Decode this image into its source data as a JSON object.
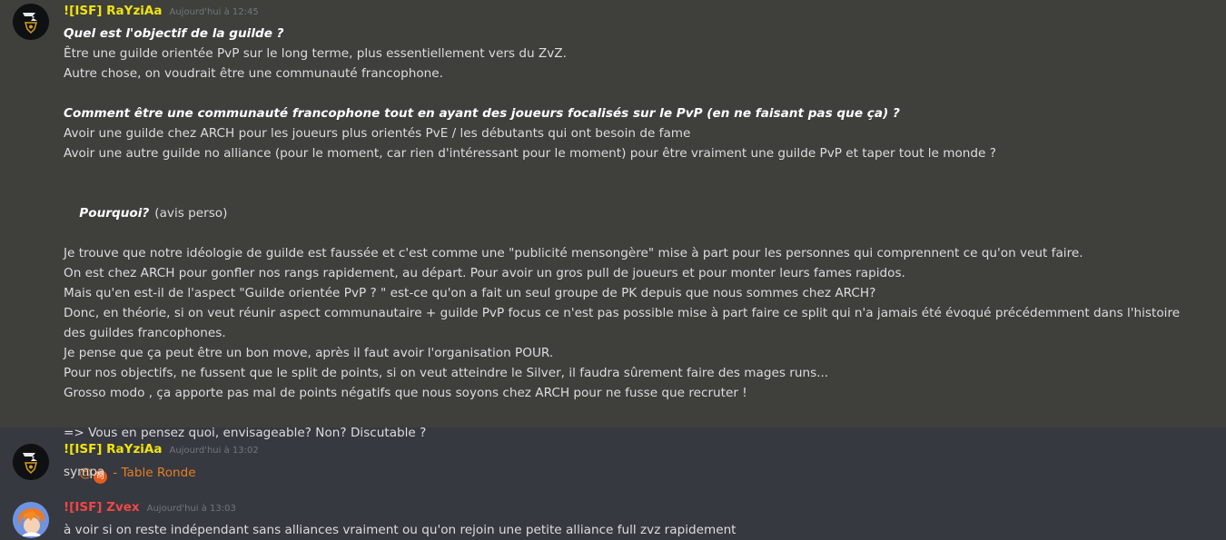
{
  "messages": {
    "m1": {
      "author": "![ISF] RaYziAa",
      "author_color": "#f1e40d",
      "timestamp": "Aujourd'hui à 12:45",
      "lines": {
        "l1": "Quel est l'objectif de la guilde ?",
        "l2": "Être une guilde orientée PvP sur le long terme, plus essentiellement vers du ZvZ.",
        "l3": "Autre chose, on voudrait être une communauté francophone.",
        "l5": "Comment être une communauté francophone tout en ayant des joueurs focalisés sur le PvP (en ne faisant pas que ça) ?",
        "l6": "Avoir une guilde chez ARCH pour les joueurs plus orientés PvE / les débutants qui ont besoin de fame",
        "l7": "Avoir une autre guilde no alliance (pour le moment, car rien d'intéressant pour le moment) pour être vraiment une guilde PvP et taper tout le monde ?",
        "l9": "Pourquoi?",
        "l9_note": "(avis perso)",
        "l10": "Je trouve que notre idéologie de guilde est faussée et c'est comme une \"publicité mensongère\" mise à part pour les personnes qui comprennent ce qu'on veut faire.",
        "l11": "On est chez ARCH pour gonfler nos rangs rapidement, au départ. Pour avoir un gros pull de joueurs et pour monter leurs fames rapidos.",
        "l12": "Mais qu'en est-il de l'aspect \"Guilde orientée PvP ? \" est-ce qu'on a fait un seul groupe de PK depuis que nous sommes chez ARCH?",
        "l13": "Donc, en théorie, si on veut réunir aspect communautaire + guilde PvP focus ce n'est pas possible mise à part faire ce split qui n'a jamais été évoqué précédemment dans l'histoire des guildes francophones.",
        "l14": "Je pense que ça peut être un bon move, après il faut avoir l'organisation POUR.",
        "l15": "Pour nos objectifs, ne fussent que le split de points, si on veut atteindre le Silver, il faudra sûrement faire des mages runs...",
        "l16": "Grosso modo , ça apporte pas mal de points négatifs que nous soyons chez ARCH pour ne fusse que recruter !",
        "l18": "=> Vous en pensez quoi, envisageable? Non? Discutable ?",
        "mention_at": "@",
        "mention_badge": "司",
        "mention_role": " - Table Ronde"
      }
    },
    "m2": {
      "author": "![ISF] RaYziAa",
      "author_color": "#f1e40d",
      "timestamp": "Aujourd'hui à 13:02",
      "text": "sympa"
    },
    "m3": {
      "author": "![ISF] Zvex",
      "author_color": "#f04747",
      "timestamp": "Aujourd'hui à 13:03",
      "text": "à voir si on reste indépendant sans alliances vraiment ou qu'on rejoin une petite alliance full zvz rapidement"
    }
  },
  "icons": {
    "avatar_rayziaa": "guild-emblem-avatar",
    "avatar_zvex": "anime-character-avatar"
  },
  "colors": {
    "background": "#36393f",
    "highlight": "#3f3f3c",
    "mention": "#e67e22"
  }
}
